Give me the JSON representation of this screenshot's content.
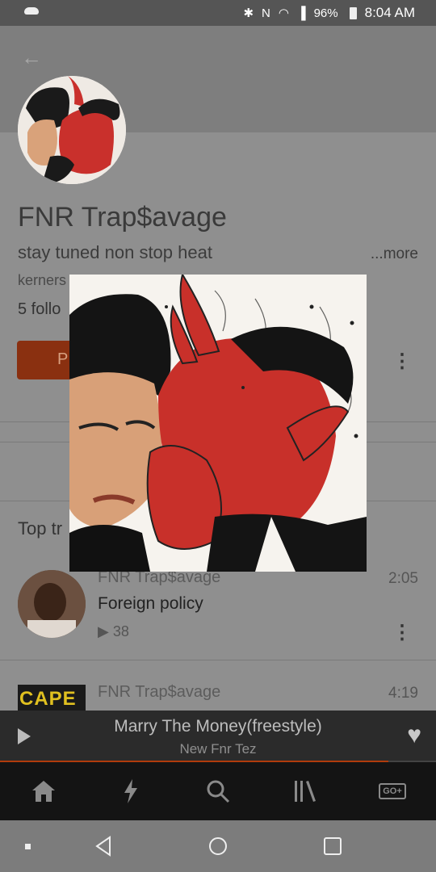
{
  "status_bar": {
    "battery": "96%",
    "time": "8:04 AM",
    "icons": [
      "cloud-icon",
      "bluetooth-icon",
      "nfc-icon",
      "wifi-icon",
      "signal-icon",
      "battery-icon"
    ]
  },
  "profile": {
    "back_icon": "arrow-left-icon",
    "name": "FNR Trap$avage",
    "bio": "stay tuned non stop heat",
    "more_label": "...more",
    "location_partial": "kerners",
    "followers_partial": "5 follo",
    "play_button_partial": "P"
  },
  "section": {
    "title_partial": "Top tr"
  },
  "tracks": [
    {
      "artist": "FNR Trap$avage",
      "title": "Foreign policy",
      "plays": "38",
      "duration": "2:05"
    },
    {
      "artist": "FNR Trap$avage",
      "title": "",
      "duration": "4:19",
      "art_text": "CAPE"
    }
  ],
  "mini_player": {
    "title": "Marry The Money(freestyle)",
    "artist": "New Fnr Tez",
    "progress": 0.89
  },
  "bottom_nav": [
    {
      "icon": "home-icon"
    },
    {
      "icon": "lightning-icon"
    },
    {
      "icon": "search-icon"
    },
    {
      "icon": "library-icon"
    },
    {
      "icon": "go-plus-icon",
      "label": "GO+"
    }
  ],
  "colors": {
    "accent": "#ff5500",
    "page_dim": "#8f8f8f",
    "mini_player": "#2b2b2b",
    "nav": "#141414"
  }
}
